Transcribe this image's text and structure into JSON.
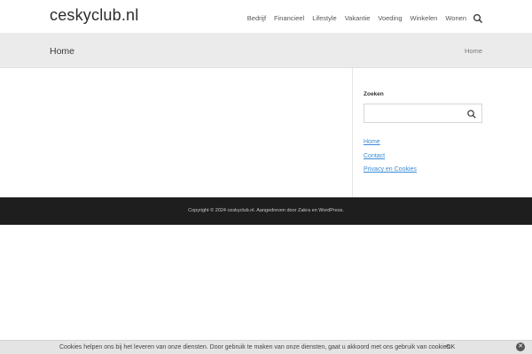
{
  "header": {
    "site_title": "ceskyclub.nl",
    "nav": [
      "Bedrijf",
      "Financieel",
      "Lifestyle",
      "Vakantie",
      "Voeding",
      "Winkelen",
      "Wonen"
    ],
    "search_icon": "search-icon"
  },
  "page_header": {
    "title": "Home",
    "breadcrumb": "Home"
  },
  "sidebar": {
    "search_title": "Zoeken",
    "search_value": "",
    "search_icon": "search-icon",
    "links": [
      "Home",
      "Contact",
      "Privacy en Cookies"
    ],
    "link_color": "#3a8bd6"
  },
  "footer": {
    "text": "Copyright © 2024 ceskyclub.nl. Aangedreven door Zakra en WordPress."
  },
  "cookie_bar": {
    "text": "Cookies helpen ons bij het leveren van onze diensten. Door gebruik te maken van onze diensten, gaat u akkoord met ons gebruik van cookies.",
    "ok_label": "OK",
    "close_icon": "close-icon"
  }
}
